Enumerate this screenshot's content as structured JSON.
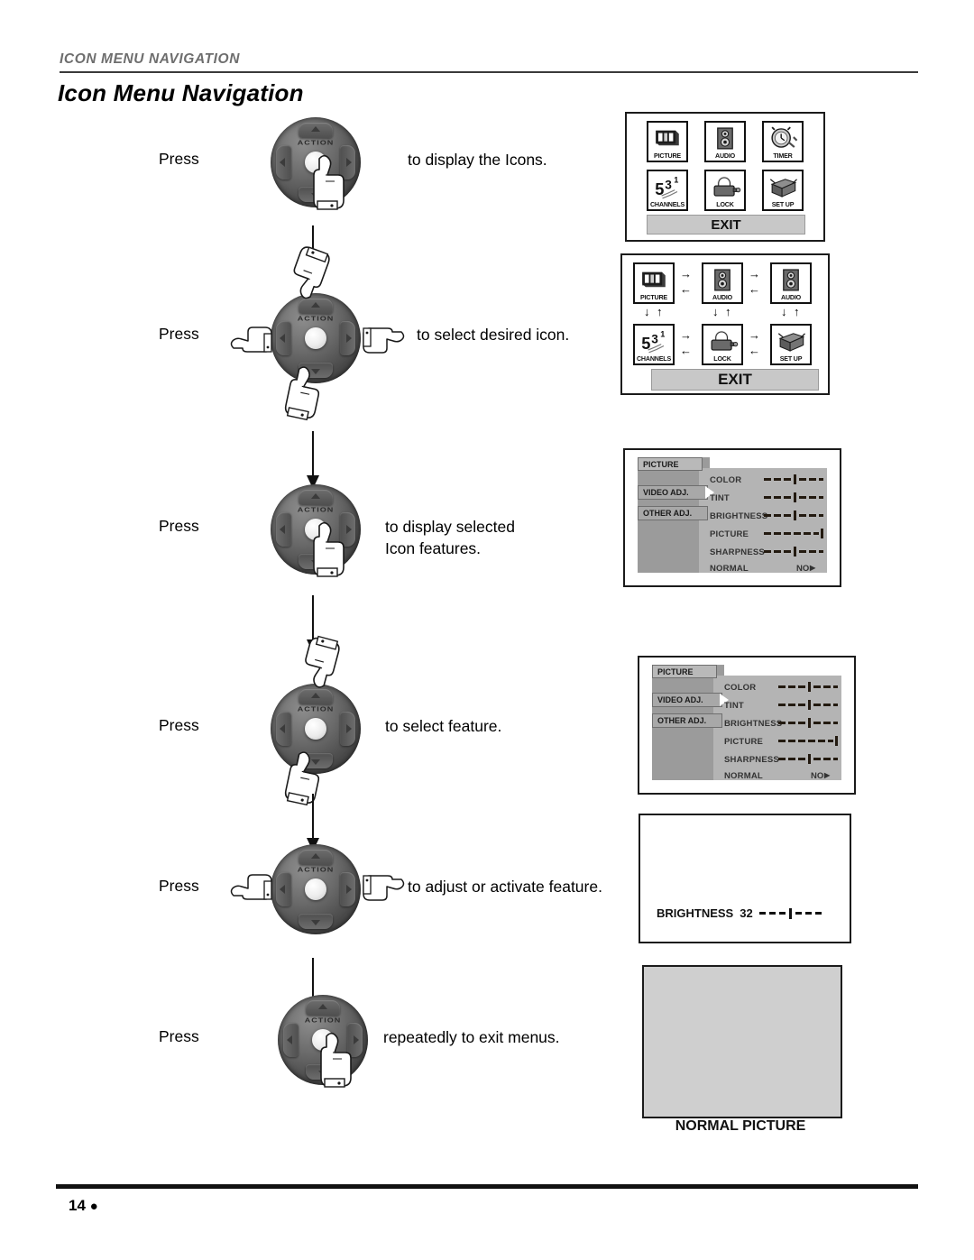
{
  "header": {
    "kicker_first": "I",
    "kicker_rest": "CON ",
    "kicker": "ICON MENU NAVIGATION",
    "title": "Icon Menu Navigation"
  },
  "footer": {
    "page_number": "14",
    "bullet": "●"
  },
  "steps": [
    {
      "press_label": "Press",
      "description": "to display the Icons.",
      "control": "action-center-button"
    },
    {
      "press_label": "Press",
      "description": "to select desired icon.",
      "control": "direction-keys"
    },
    {
      "press_label": "Press",
      "description": "to display selected\nIcon features.",
      "description_line1": "to display selected",
      "description_line2": "Icon features.",
      "control": "action-center-button"
    },
    {
      "press_label": "Press",
      "description": "to select feature.",
      "control": "up-down-keys"
    },
    {
      "press_label": "Press",
      "description": "to adjust or activate feature.",
      "control": "left-right-keys"
    },
    {
      "press_label": "Press",
      "description": "repeatedly to exit menus.",
      "control": "action-center-button"
    }
  ],
  "action_pad": {
    "label": "ACTION"
  },
  "icon_menu_1": {
    "icons": [
      {
        "label": "PICTURE",
        "glyph": "tv-icon"
      },
      {
        "label": "AUDIO",
        "glyph": "speaker-icon"
      },
      {
        "label": "TIMER",
        "glyph": "clock-icon"
      },
      {
        "label": "CHANNELS",
        "glyph": "channels-icon"
      },
      {
        "label": "LOCK",
        "glyph": "padlock-icon"
      },
      {
        "label": "SET UP",
        "glyph": "setup-icon"
      }
    ],
    "exit_label": "EXIT"
  },
  "icon_menu_2": {
    "icons": [
      {
        "label": "PICTURE",
        "glyph": "tv-icon",
        "selected": false
      },
      {
        "label": "AUDIO",
        "glyph": "speaker-icon",
        "selected": true
      },
      {
        "label": "AUDIO",
        "glyph": "speaker-icon",
        "selected": false
      },
      {
        "label": "CHANNELS",
        "glyph": "channels-icon",
        "selected": false
      },
      {
        "label": "LOCK",
        "glyph": "padlock-icon",
        "selected": true
      },
      {
        "label": "SET UP",
        "glyph": "setup-icon",
        "selected": false
      }
    ],
    "exit_label": "EXIT",
    "arrows": {
      "right": "→",
      "left": "←",
      "down": "↓",
      "up": "↑"
    }
  },
  "picture_menu": {
    "tabs": [
      {
        "label": "PICTURE",
        "active": true
      },
      {
        "label": "VIDEO ADJ.",
        "active": false
      },
      {
        "label": "OTHER ADJ.",
        "active": false
      }
    ],
    "cursor_on_tab": "VIDEO ADJ.",
    "rows": [
      {
        "label": "COLOR",
        "control": "slider",
        "position": "center"
      },
      {
        "label": "TINT",
        "control": "slider",
        "position": "center"
      },
      {
        "label": "BRIGHTNESS",
        "control": "slider",
        "position": "center"
      },
      {
        "label": "PICTURE",
        "control": "slider",
        "position": "max"
      },
      {
        "label": "SHARPNESS",
        "control": "slider",
        "position": "center"
      },
      {
        "label": "NORMAL",
        "control": "value",
        "value": "NO",
        "arrow": "▶"
      }
    ]
  },
  "brightness_osd": {
    "label": "BRIGHTNESS",
    "value": "32"
  },
  "normal_picture": {
    "caption": "NORMAL PICTURE"
  }
}
